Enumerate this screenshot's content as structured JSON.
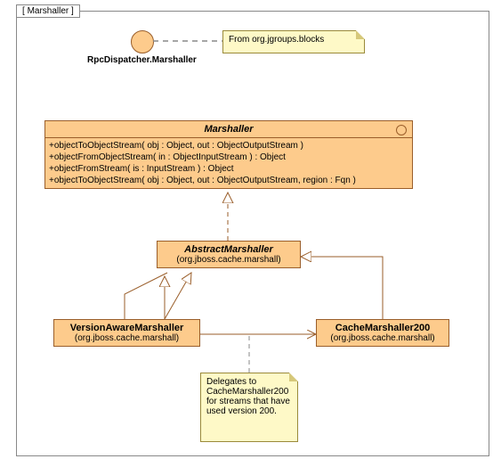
{
  "frame": {
    "title": "Marshaller"
  },
  "interface_ball": {
    "label": "RpcDispatcher.Marshaller"
  },
  "note_top": {
    "text": "From org.jgroups.blocks"
  },
  "marshaller_class": {
    "name": "Marshaller",
    "ops": [
      "+objectToObjectStream( obj : Object, out : ObjectOutputStream )",
      "+objectFromObjectStream( in : ObjectInputStream ) : Object",
      "+objectFromStream( is : InputStream ) : Object",
      "+objectToObjectStream( obj : Object, out : ObjectOutputStream, region : Fqn )"
    ]
  },
  "abstract_marshaller": {
    "name": "AbstractMarshaller",
    "pkg": "(org.jboss.cache.marshall)"
  },
  "version_aware": {
    "name": "VersionAwareMarshaller",
    "pkg": "(org.jboss.cache.marshall)"
  },
  "cache_200": {
    "name": "CacheMarshaller200",
    "pkg": "(org.jboss.cache.marshall)"
  },
  "note_bottom": {
    "text": "Delegates to CacheMarshaller200 for streams that have used version 200."
  }
}
